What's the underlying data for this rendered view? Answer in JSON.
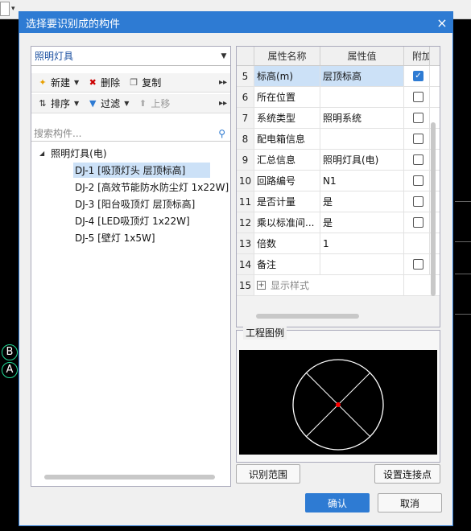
{
  "dialog": {
    "title": "选择要识别成的构件",
    "close_label": "×"
  },
  "category_combo": {
    "value": "照明灯具"
  },
  "toolbar1": {
    "new_label": "新建",
    "delete_label": "删除",
    "copy_label": "复制"
  },
  "toolbar2": {
    "sort_label": "排序",
    "filter_label": "过滤",
    "moveup_label": "上移"
  },
  "search": {
    "placeholder": "搜索构件..."
  },
  "tree": {
    "root_label": "照明灯具(电)",
    "items": [
      {
        "label": "DJ-1 [吸顶灯头 层顶标高]",
        "selected": true
      },
      {
        "label": "DJ-2 [高效节能防水防尘灯 1x22W]"
      },
      {
        "label": "DJ-3 [阳台吸顶灯 层顶标高]"
      },
      {
        "label": "DJ-4 [LED吸顶灯 1x22W]"
      },
      {
        "label": "DJ-5 [壁灯 1x5W]"
      }
    ]
  },
  "grid": {
    "headers": {
      "name": "属性名称",
      "value": "属性值",
      "add": "附加"
    },
    "rows": [
      {
        "num": "5",
        "name": "标高(m)",
        "value": "层顶标高",
        "check": "checked"
      },
      {
        "num": "6",
        "name": "所在位置",
        "value": "",
        "check": "unchecked"
      },
      {
        "num": "7",
        "name": "系统类型",
        "value": "照明系统",
        "check": "unchecked"
      },
      {
        "num": "8",
        "name": "配电箱信息",
        "value": "",
        "check": "unchecked"
      },
      {
        "num": "9",
        "name": "汇总信息",
        "value": "照明灯具(电)",
        "check": "unchecked"
      },
      {
        "num": "10",
        "name": "回路编号",
        "value": "N1",
        "check": "unchecked"
      },
      {
        "num": "11",
        "name": "是否计量",
        "value": "是",
        "check": "unchecked"
      },
      {
        "num": "12",
        "name": "乘以标准间...",
        "value": "是",
        "check": "unchecked"
      },
      {
        "num": "13",
        "name": "倍数",
        "value": "1",
        "check": "none"
      },
      {
        "num": "14",
        "name": "备注",
        "value": "",
        "check": "unchecked"
      }
    ],
    "footer_row": {
      "num": "15",
      "label": "显示样式"
    }
  },
  "legend": {
    "title": "工程图例"
  },
  "buttons": {
    "identify_range": "识别范围",
    "set_connect_point": "设置连接点",
    "confirm": "确认",
    "cancel": "取消"
  },
  "axis": {
    "b": "B",
    "a": "A"
  },
  "colors": {
    "accent": "#2e7bd3",
    "selection": "#cce1f7",
    "legend_center": "#ff0000"
  }
}
